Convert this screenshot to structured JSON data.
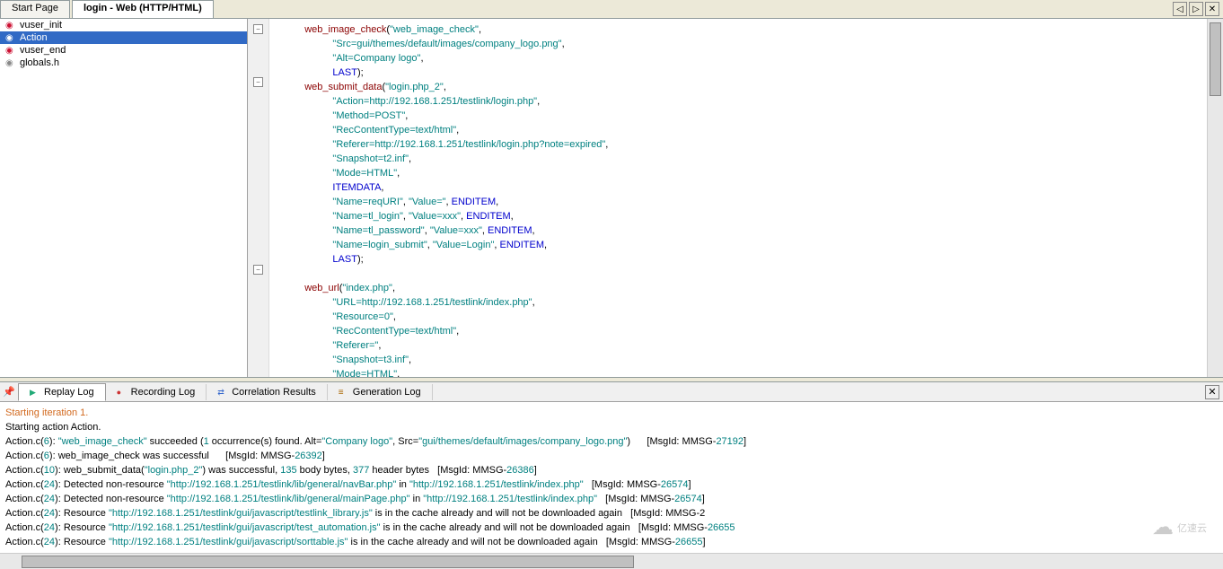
{
  "tabs": {
    "start": "Start Page",
    "login": "login - Web (HTTP/HTML)"
  },
  "tabControls": {
    "left": "◁",
    "right": "▷",
    "close": "✕"
  },
  "sidebar": {
    "items": [
      {
        "name": "vuser_init",
        "icon": "func"
      },
      {
        "name": "Action",
        "icon": "func",
        "selected": true
      },
      {
        "name": "vuser_end",
        "icon": "func"
      },
      {
        "name": "globals.h",
        "icon": "file"
      }
    ]
  },
  "fold": {
    "minus": "−"
  },
  "code": {
    "l1a": "web_image_check",
    "l1b": "(",
    "l1c": "\"web_image_check\"",
    "l1d": ",",
    "l2a": "\"Src=gui/themes/default/images/company_logo.png\"",
    "l2b": ",",
    "l3a": "\"Alt=Company logo\"",
    "l3b": ",",
    "l4a": "LAST",
    "l4b": ");",
    "l5a": "web_submit_data",
    "l5b": "(",
    "l5c": "\"login.php_2\"",
    "l5d": ",",
    "l6a": "\"Action=http://192.168.1.251/testlink/login.php\"",
    "l6b": ",",
    "l7a": "\"Method=POST\"",
    "l7b": ",",
    "l8a": "\"RecContentType=text/html\"",
    "l8b": ",",
    "l9a": "\"Referer=http://192.168.1.251/testlink/login.php?note=expired\"",
    "l9b": ",",
    "l10a": "\"Snapshot=t2.inf\"",
    "l10b": ",",
    "l11a": "\"Mode=HTML\"",
    "l11b": ",",
    "l12a": "ITEMDATA",
    "l12b": ",",
    "l13a": "\"Name=reqURI\"",
    "l13b": ", ",
    "l13c": "\"Value=\"",
    "l13d": ", ",
    "l13e": "ENDITEM",
    "l13f": ",",
    "l14a": "\"Name=tl_login\"",
    "l14b": ", ",
    "l14c": "\"Value=xxx\"",
    "l14d": ", ",
    "l14e": "ENDITEM",
    "l14f": ",",
    "l15a": "\"Name=tl_password\"",
    "l15b": ", ",
    "l15c": "\"Value=xxx\"",
    "l15d": ", ",
    "l15e": "ENDITEM",
    "l15f": ",",
    "l16a": "\"Name=login_submit\"",
    "l16b": ", ",
    "l16c": "\"Value=Login\"",
    "l16d": ", ",
    "l16e": "ENDITEM",
    "l16f": ",",
    "l17a": "LAST",
    "l17b": ");",
    "l18": "",
    "l19a": "web_url",
    "l19b": "(",
    "l19c": "\"index.php\"",
    "l19d": ",",
    "l20a": "\"URL=http://192.168.1.251/testlink/index.php\"",
    "l20b": ",",
    "l21a": "\"Resource=0\"",
    "l21b": ",",
    "l22a": "\"RecContentType=text/html\"",
    "l22b": ",",
    "l23a": "\"Referer=\"",
    "l23b": ",",
    "l24a": "\"Snapshot=t3.inf\"",
    "l24b": ",",
    "l25a": "\"Mode=HTML\"",
    "l25b": ","
  },
  "logtabs": {
    "pin": "📌",
    "replay": "Replay Log",
    "recording": "Recording Log",
    "corr": "Correlation Results",
    "gen": "Generation Log",
    "close": "✕"
  },
  "log": {
    "l1": "Starting iteration 1.",
    "l2": "Starting action Action.",
    "l3a": "Action.c(",
    "l3b": "6",
    "l3c": "): ",
    "l3d": "\"web_image_check\"",
    "l3e": " succeeded (",
    "l3f": "1",
    "l3g": " occurrence(s) found. Alt=",
    "l3h": "\"Company logo\"",
    "l3i": ", Src=",
    "l3j": "\"gui/themes/default/images/company_logo.png\"",
    "l3k": ")      [MsgId: MMSG-",
    "l3l": "27192",
    "l3m": "]",
    "l4a": "Action.c(",
    "l4b": "6",
    "l4c": "): web_image_check was successful      [MsgId: MMSG-",
    "l4d": "26392",
    "l4e": "]",
    "l5a": "Action.c(",
    "l5b": "10",
    "l5c": "): web_submit_data(",
    "l5d": "\"login.php_2\"",
    "l5e": ") was successful, ",
    "l5f": "135",
    "l5g": " body bytes, ",
    "l5h": "377",
    "l5i": " header bytes   [MsgId: MMSG-",
    "l5j": "26386",
    "l5k": "]",
    "l6a": "Action.c(",
    "l6b": "24",
    "l6c": "): Detected non-resource ",
    "l6d": "\"http://192.168.1.251/testlink/lib/general/navBar.php\"",
    "l6e": " in ",
    "l6f": "\"http://192.168.1.251/testlink/index.php\"",
    "l6g": "   [MsgId: MMSG-",
    "l6h": "26574",
    "l6i": "]",
    "l7a": "Action.c(",
    "l7b": "24",
    "l7c": "): Detected non-resource ",
    "l7d": "\"http://192.168.1.251/testlink/lib/general/mainPage.php\"",
    "l7e": " in ",
    "l7f": "\"http://192.168.1.251/testlink/index.php\"",
    "l7g": "   [MsgId: MMSG-",
    "l7h": "26574",
    "l7i": "]",
    "l8a": "Action.c(",
    "l8b": "24",
    "l8c": "): Resource ",
    "l8d": "\"http://192.168.1.251/testlink/gui/javascript/testlink_library.js\"",
    "l8e": " is in the cache already and will not be downloaded again   [MsgId: MMSG-2",
    "l9a": "Action.c(",
    "l9b": "24",
    "l9c": "): Resource ",
    "l9d": "\"http://192.168.1.251/testlink/gui/javascript/test_automation.js\"",
    "l9e": " is in the cache already and will not be downloaded again   [MsgId: MMSG-",
    "l9f": "26655",
    "l10a": "Action.c(",
    "l10b": "24",
    "l10c": "): Resource ",
    "l10d": "\"http://192.168.1.251/testlink/gui/javascript/sorttable.js\"",
    "l10e": " is in the cache already and will not be downloaded again   [MsgId: MMSG-",
    "l10f": "26655",
    "l10g": "]"
  },
  "watermark": {
    "icon": "☁",
    "text": "亿速云"
  }
}
